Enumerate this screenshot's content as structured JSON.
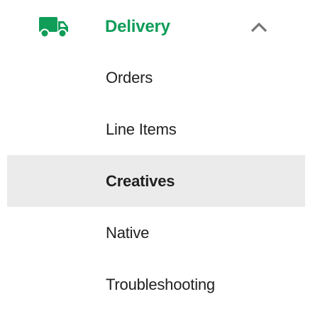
{
  "section": {
    "title": "Delivery",
    "icon": "delivery-truck-icon",
    "expanded_icon": "chevron-up-icon",
    "accent_color": "#0f9d58"
  },
  "items": [
    {
      "label": "Orders",
      "selected": false
    },
    {
      "label": "Line Items",
      "selected": false
    },
    {
      "label": "Creatives",
      "selected": true
    },
    {
      "label": "Native",
      "selected": false
    },
    {
      "label": "Troubleshooting",
      "selected": false
    }
  ],
  "colors": {
    "selected_background": "#ebebeb",
    "text": "#212121",
    "chevron": "#757575"
  }
}
